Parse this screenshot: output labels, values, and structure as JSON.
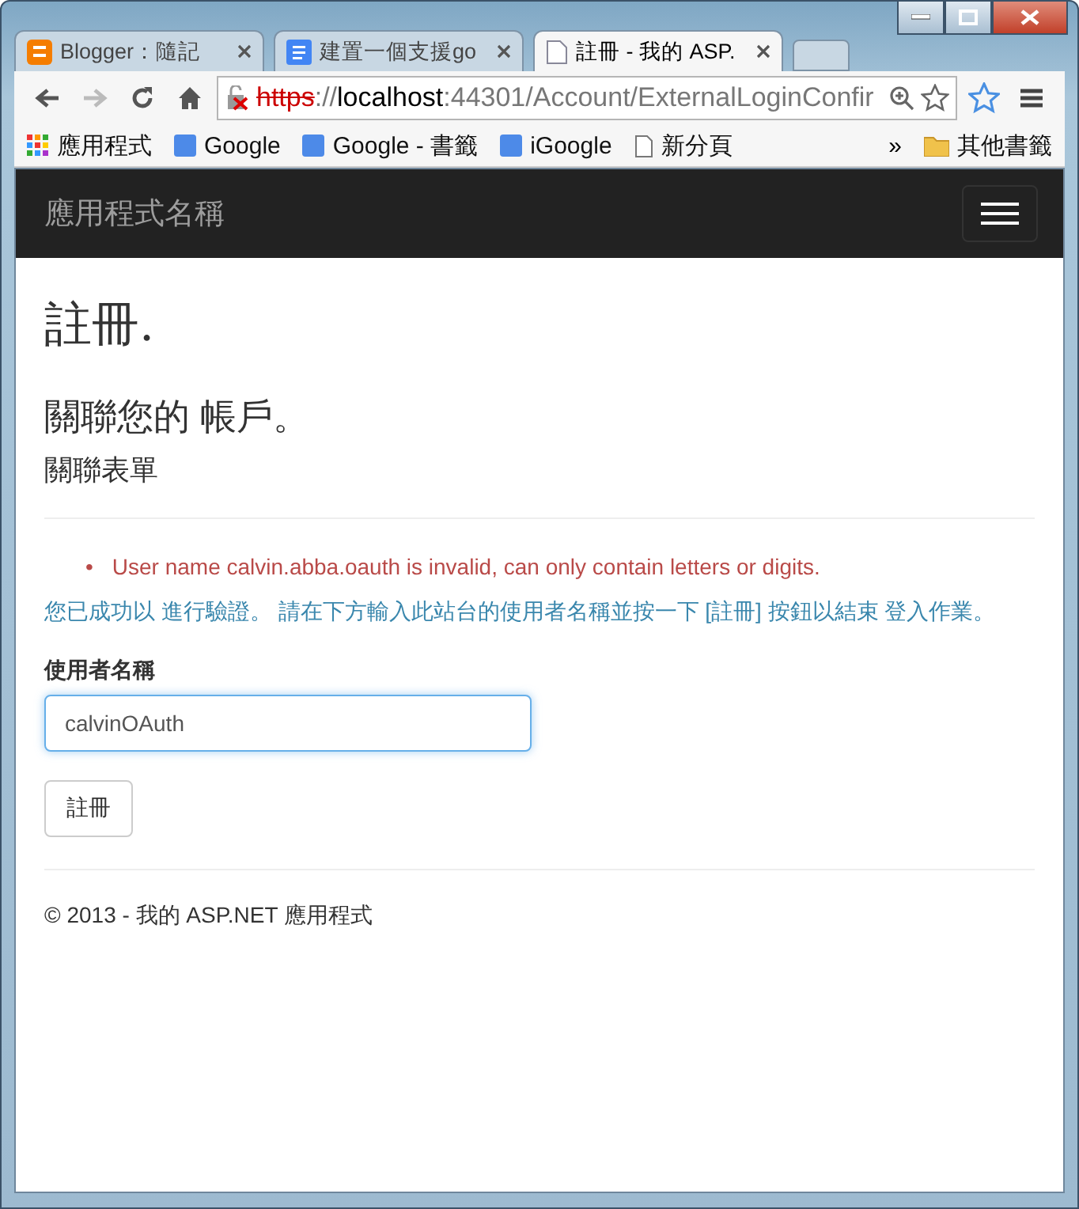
{
  "browser": {
    "tabs": [
      {
        "title": "Blogger：隨記",
        "kind": "blogger",
        "selected": false
      },
      {
        "title": "建置一個支援go",
        "kind": "doc",
        "selected": false
      },
      {
        "title": "註冊 - 我的 ASP.",
        "kind": "page",
        "selected": true
      }
    ],
    "address": {
      "scheme": "https",
      "separator": "://",
      "host": "localhost",
      "path": ":44301/Account/ExternalLoginConfir",
      "secure": false
    },
    "bookmarks": [
      {
        "label": "應用程式",
        "kind": "apps"
      },
      {
        "label": "Google",
        "kind": "google"
      },
      {
        "label": "Google - 書籤",
        "kind": "google"
      },
      {
        "label": "iGoogle",
        "kind": "google"
      },
      {
        "label": "新分頁",
        "kind": "page"
      }
    ],
    "overflow": "»",
    "other_bookmarks": "其他書籤"
  },
  "navbar": {
    "brand": "應用程式名稱"
  },
  "page": {
    "title": "註冊.",
    "subtitle": "關聯您的 帳戶。",
    "section": "關聯表單",
    "bullet": "•",
    "errors": [
      "User name calvin.abba.oauth is invalid, can only contain letters or digits."
    ],
    "info": "您已成功以 進行驗證。 請在下方輸入此站台的使用者名稱並按一下 [註冊] 按鈕以結束 登入作業。",
    "field": {
      "label": "使用者名稱",
      "value": "calvinOAuth",
      "focused": true
    },
    "submit": "註冊",
    "footer": "© 2013 - 我的 ASP.NET 應用程式"
  }
}
